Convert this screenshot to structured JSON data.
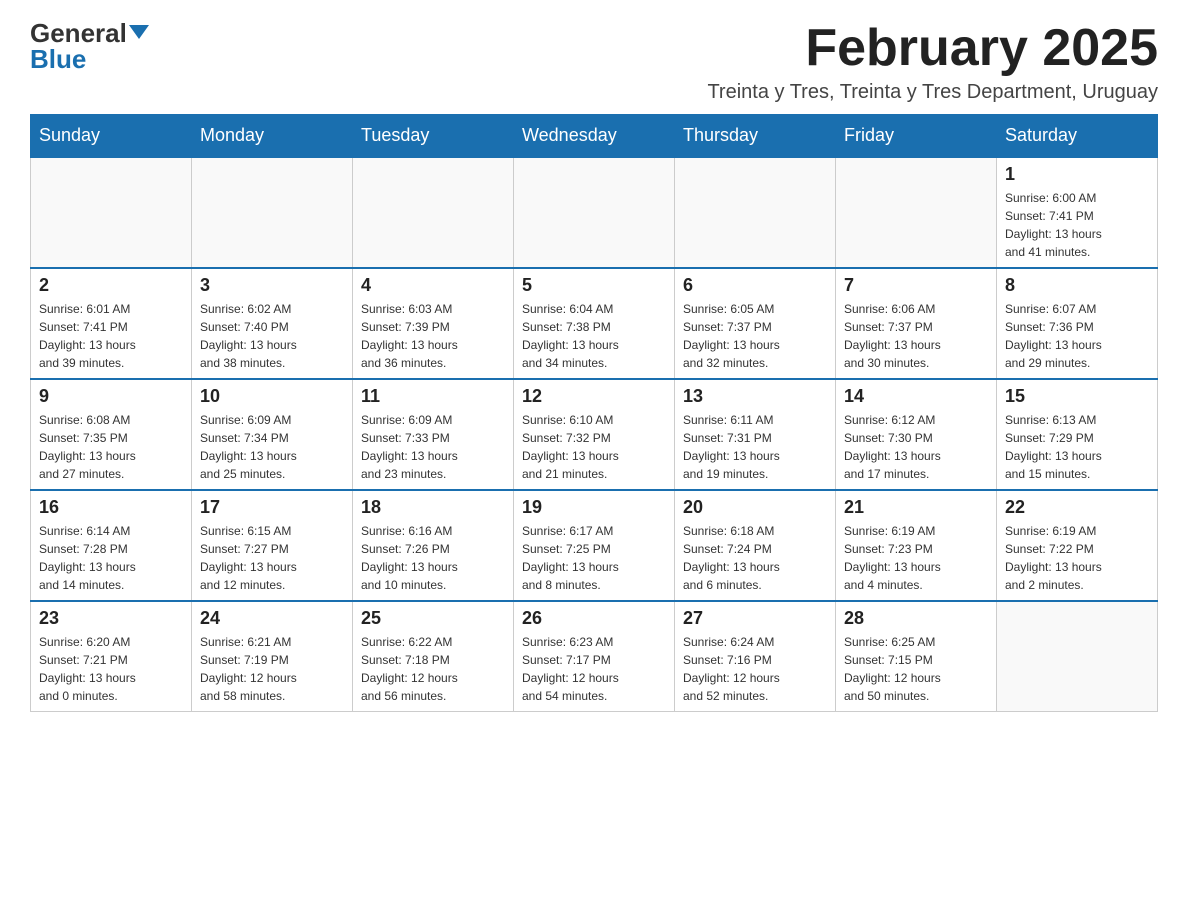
{
  "logo": {
    "general": "General",
    "blue": "Blue"
  },
  "title": "February 2025",
  "subtitle": "Treinta y Tres, Treinta y Tres Department, Uruguay",
  "days_of_week": [
    "Sunday",
    "Monday",
    "Tuesday",
    "Wednesday",
    "Thursday",
    "Friday",
    "Saturday"
  ],
  "weeks": [
    [
      {
        "day": "",
        "info": ""
      },
      {
        "day": "",
        "info": ""
      },
      {
        "day": "",
        "info": ""
      },
      {
        "day": "",
        "info": ""
      },
      {
        "day": "",
        "info": ""
      },
      {
        "day": "",
        "info": ""
      },
      {
        "day": "1",
        "info": "Sunrise: 6:00 AM\nSunset: 7:41 PM\nDaylight: 13 hours\nand 41 minutes."
      }
    ],
    [
      {
        "day": "2",
        "info": "Sunrise: 6:01 AM\nSunset: 7:41 PM\nDaylight: 13 hours\nand 39 minutes."
      },
      {
        "day": "3",
        "info": "Sunrise: 6:02 AM\nSunset: 7:40 PM\nDaylight: 13 hours\nand 38 minutes."
      },
      {
        "day": "4",
        "info": "Sunrise: 6:03 AM\nSunset: 7:39 PM\nDaylight: 13 hours\nand 36 minutes."
      },
      {
        "day": "5",
        "info": "Sunrise: 6:04 AM\nSunset: 7:38 PM\nDaylight: 13 hours\nand 34 minutes."
      },
      {
        "day": "6",
        "info": "Sunrise: 6:05 AM\nSunset: 7:37 PM\nDaylight: 13 hours\nand 32 minutes."
      },
      {
        "day": "7",
        "info": "Sunrise: 6:06 AM\nSunset: 7:37 PM\nDaylight: 13 hours\nand 30 minutes."
      },
      {
        "day": "8",
        "info": "Sunrise: 6:07 AM\nSunset: 7:36 PM\nDaylight: 13 hours\nand 29 minutes."
      }
    ],
    [
      {
        "day": "9",
        "info": "Sunrise: 6:08 AM\nSunset: 7:35 PM\nDaylight: 13 hours\nand 27 minutes."
      },
      {
        "day": "10",
        "info": "Sunrise: 6:09 AM\nSunset: 7:34 PM\nDaylight: 13 hours\nand 25 minutes."
      },
      {
        "day": "11",
        "info": "Sunrise: 6:09 AM\nSunset: 7:33 PM\nDaylight: 13 hours\nand 23 minutes."
      },
      {
        "day": "12",
        "info": "Sunrise: 6:10 AM\nSunset: 7:32 PM\nDaylight: 13 hours\nand 21 minutes."
      },
      {
        "day": "13",
        "info": "Sunrise: 6:11 AM\nSunset: 7:31 PM\nDaylight: 13 hours\nand 19 minutes."
      },
      {
        "day": "14",
        "info": "Sunrise: 6:12 AM\nSunset: 7:30 PM\nDaylight: 13 hours\nand 17 minutes."
      },
      {
        "day": "15",
        "info": "Sunrise: 6:13 AM\nSunset: 7:29 PM\nDaylight: 13 hours\nand 15 minutes."
      }
    ],
    [
      {
        "day": "16",
        "info": "Sunrise: 6:14 AM\nSunset: 7:28 PM\nDaylight: 13 hours\nand 14 minutes."
      },
      {
        "day": "17",
        "info": "Sunrise: 6:15 AM\nSunset: 7:27 PM\nDaylight: 13 hours\nand 12 minutes."
      },
      {
        "day": "18",
        "info": "Sunrise: 6:16 AM\nSunset: 7:26 PM\nDaylight: 13 hours\nand 10 minutes."
      },
      {
        "day": "19",
        "info": "Sunrise: 6:17 AM\nSunset: 7:25 PM\nDaylight: 13 hours\nand 8 minutes."
      },
      {
        "day": "20",
        "info": "Sunrise: 6:18 AM\nSunset: 7:24 PM\nDaylight: 13 hours\nand 6 minutes."
      },
      {
        "day": "21",
        "info": "Sunrise: 6:19 AM\nSunset: 7:23 PM\nDaylight: 13 hours\nand 4 minutes."
      },
      {
        "day": "22",
        "info": "Sunrise: 6:19 AM\nSunset: 7:22 PM\nDaylight: 13 hours\nand 2 minutes."
      }
    ],
    [
      {
        "day": "23",
        "info": "Sunrise: 6:20 AM\nSunset: 7:21 PM\nDaylight: 13 hours\nand 0 minutes."
      },
      {
        "day": "24",
        "info": "Sunrise: 6:21 AM\nSunset: 7:19 PM\nDaylight: 12 hours\nand 58 minutes."
      },
      {
        "day": "25",
        "info": "Sunrise: 6:22 AM\nSunset: 7:18 PM\nDaylight: 12 hours\nand 56 minutes."
      },
      {
        "day": "26",
        "info": "Sunrise: 6:23 AM\nSunset: 7:17 PM\nDaylight: 12 hours\nand 54 minutes."
      },
      {
        "day": "27",
        "info": "Sunrise: 6:24 AM\nSunset: 7:16 PM\nDaylight: 12 hours\nand 52 minutes."
      },
      {
        "day": "28",
        "info": "Sunrise: 6:25 AM\nSunset: 7:15 PM\nDaylight: 12 hours\nand 50 minutes."
      },
      {
        "day": "",
        "info": ""
      }
    ]
  ]
}
